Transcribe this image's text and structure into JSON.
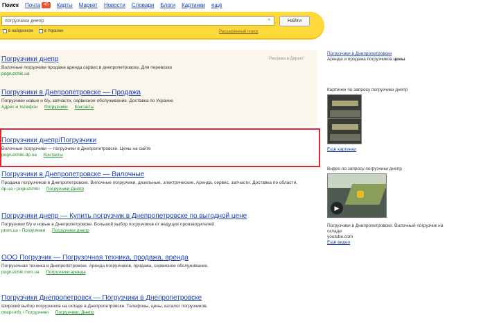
{
  "topnav": {
    "items": [
      "Поиск",
      "Почта",
      "Карты",
      "Маркет",
      "Новости",
      "Словари",
      "Блоги",
      "Картинки",
      "ещё"
    ],
    "badge": "45"
  },
  "search": {
    "query": "погрузчики днепр",
    "clear_icon": "×",
    "button_label": "Найти",
    "option1": "в найденном",
    "option2": "в Украине",
    "advanced_link": "Расширенный поиск"
  },
  "ads": {
    "label": "Реклама в Директ",
    "items": [
      {
        "title": "Погрузчики днепр",
        "snippet": "Вилочные погрузчики продажа аренда сервис в днепропетровске. Для перевозки",
        "url": "pogruzchik.ua"
      },
      {
        "title": "Погрузчики в Днепропетровске — Продажа",
        "snippet": "Погрузчики новые и б/у, запчасти, сервисное обслуживание. Доставка по Украине",
        "url": "Адрес и телефон",
        "more1": "Погрузчики",
        "more2": "Контакты"
      }
    ]
  },
  "results": [
    {
      "title": "Погрузчики днепр/Погрузчики",
      "snippet": "Вилочные погрузчики — погрузчики в Днепропетровске. Цены на сайте",
      "url": "pogruzchiki.dp.ua",
      "more": "Контакты"
    },
    {
      "title": "Погрузчики в Днепропетровске — Вилочные",
      "snippet": "Продажа погрузчиков в Днепропетровске. Вилочные погрузчики, дизельные, электрические. Аренда, сервис, запчасти. Доставка по области.",
      "url": "dp.ua › pogruzchiki",
      "more": "Погрузчики Днепр"
    },
    {
      "title": "Погрузчики днепр — Купить погрузчик в Днепропетровске по выгодной цене",
      "snippet": "Погрузчики б/у и новые в Днепропетровске. Большой выбор погрузчиков от ведущих производителей.",
      "url": "prom.ua › Погрузчики",
      "more": "Погрузчики днепр"
    },
    {
      "title": "ООО Погрузчик — Погрузочная техника, продажа, аренда",
      "snippet": "Погрузочная техника в Днепропетровске. Аренда погрузчиков, продажа, сервисное обслуживание.",
      "url": "pogruzchik.com.ua",
      "more": "Погрузчики аренда"
    },
    {
      "title": "Погрузчики Днепропетровск — Погрузчики в Днепропетровске",
      "snippet": "Широкий выбор погрузчиков на складе в Днепропетровске. Телефоны, цены, каталог погрузчиков.",
      "url": "dnepr.info › Погрузчики",
      "more": "Погрузчики, Днепр"
    }
  ],
  "right": {
    "ad_title": "Погрузчики в Днепропетровске",
    "ad_text": "Аренда и продажа погрузчиков",
    "ad_extra": "цены",
    "images_header": "Картинки по запросу погрузчики днепр",
    "images_link": "Ещё картинки",
    "video_header": "Видео по запросу погрузчики днепр",
    "video_play": "▶",
    "video_caption": "Погрузчики в Днепропетровске. Вилочный погрузчик на складе",
    "video_source": "youtube.com",
    "video_link": "Ещё видео"
  }
}
